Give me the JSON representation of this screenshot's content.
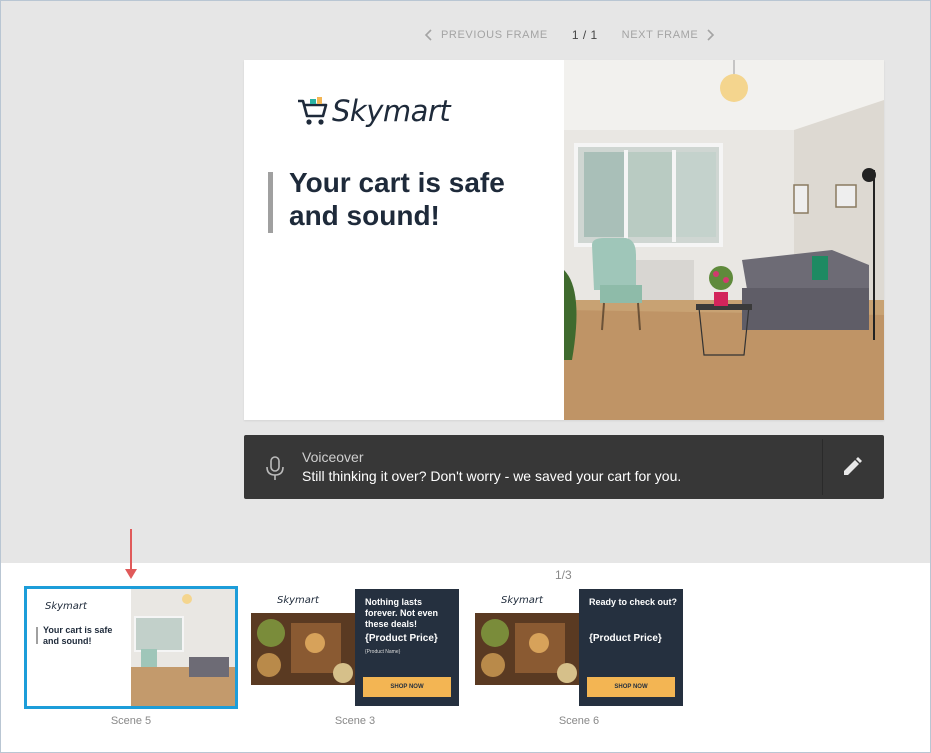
{
  "nav": {
    "previous_label": "PREVIOUS FRAME",
    "next_label": "NEXT FRAME",
    "count": "1 / 1"
  },
  "preview": {
    "brand": "Skymart",
    "headline": "Your cart is safe and sound!"
  },
  "voiceover": {
    "title": "Voiceover",
    "text": "Still thinking it over? Don't worry - we saved your cart for you."
  },
  "scenes": {
    "pager": "1/3",
    "items": [
      {
        "label": "Scene 5",
        "brand": "Skymart",
        "headline": "Your cart is safe and sound!"
      },
      {
        "label": "Scene 3",
        "brand": "Skymart",
        "headline": "Nothing lasts forever. Not even these deals!",
        "price": "{Product Price}",
        "name": "{Product Name}",
        "button": "SHOP NOW"
      },
      {
        "label": "Scene 6",
        "brand": "Skymart",
        "headline": "Ready to check out?",
        "price": "{Product Price}",
        "button": "SHOP NOW"
      }
    ]
  },
  "colors": {
    "accent": "#1d9dd9",
    "brand_dark": "#1e2a3a",
    "cta": "#f3b553",
    "indicator_arrow": "#e05a5a"
  }
}
